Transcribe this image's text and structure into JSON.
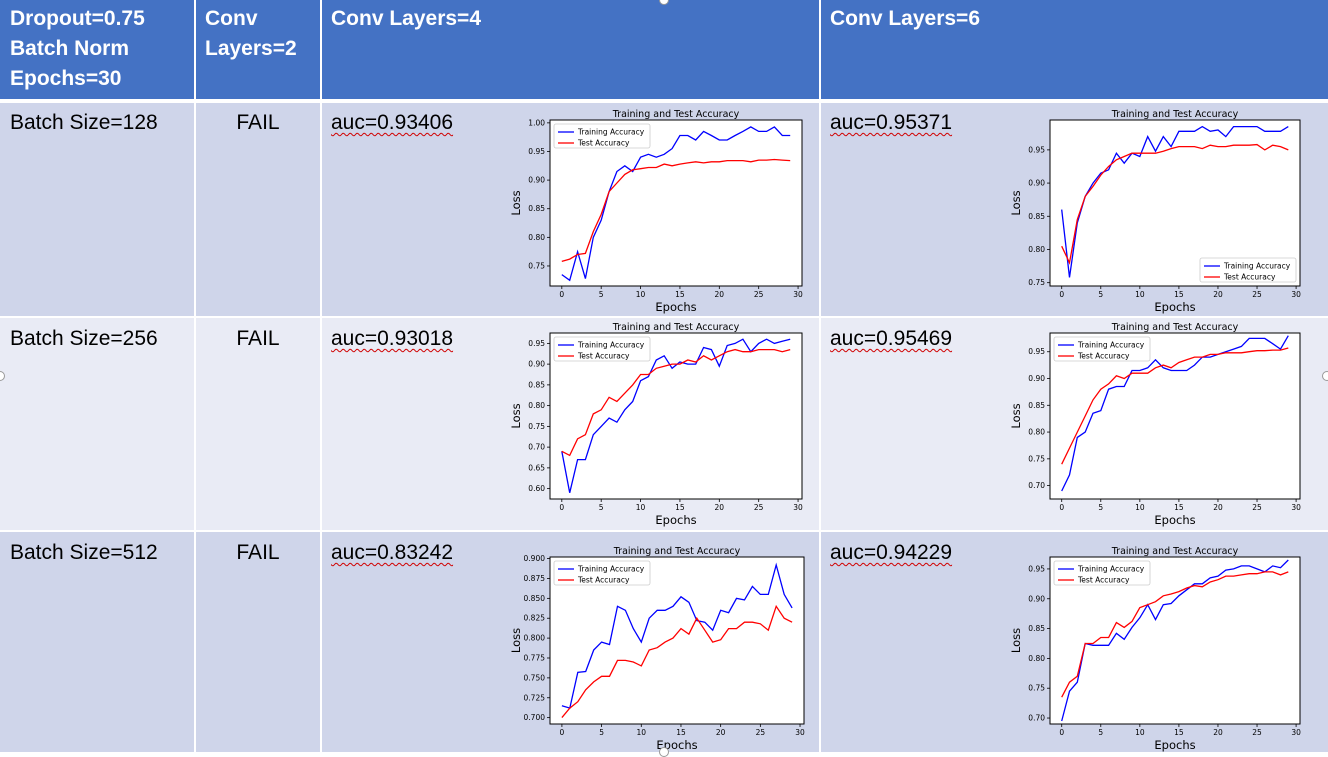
{
  "header": {
    "col1_lines": [
      "Dropout=0.75",
      "Batch Norm",
      "Epochs=30"
    ],
    "col2_lines": [
      "Conv",
      "Layers=2"
    ],
    "col3": "Conv Layers=4",
    "col4": "Conv Layers=6"
  },
  "rows": [
    {
      "batch": "Batch Size=128",
      "conv2": "FAIL",
      "auc4": "auc=0.93406",
      "auc6": "auc=0.95371"
    },
    {
      "batch": "Batch Size=256",
      "conv2": "FAIL",
      "auc4": "auc=0.93018",
      "auc6": "auc=0.95469"
    },
    {
      "batch": "Batch Size=512",
      "conv2": "FAIL",
      "auc4": "auc=0.83242",
      "auc6": "auc=0.94229"
    }
  ],
  "colors": {
    "header": "#4472c4",
    "row_even": "#cfd5ea",
    "row_odd": "#e9ebf5",
    "train": "#0000ff",
    "test": "#ff0000"
  },
  "chart_data": [
    {
      "type": "line",
      "title": "Training and Test Accuracy",
      "xlabel": "Epochs",
      "ylabel": "Loss",
      "ylim": [
        0.715,
        1.005
      ],
      "xlim": [
        -1.5,
        30.5
      ],
      "yticks": [
        "0.75",
        "0.80",
        "0.85",
        "0.90",
        "0.95",
        "1.00"
      ],
      "xticks": [
        "0",
        "5",
        "10",
        "15",
        "20",
        "25",
        "30"
      ],
      "legend_position": "top-left",
      "x": [
        0,
        1,
        2,
        3,
        4,
        5,
        6,
        7,
        8,
        9,
        10,
        11,
        12,
        13,
        14,
        15,
        16,
        17,
        18,
        19,
        20,
        21,
        22,
        23,
        24,
        25,
        26,
        27,
        28,
        29
      ],
      "series": [
        {
          "name": "Training Accuracy",
          "color": "#0000ff",
          "values": [
            0.735,
            0.725,
            0.775,
            0.728,
            0.8,
            0.83,
            0.88,
            0.915,
            0.925,
            0.915,
            0.94,
            0.945,
            0.94,
            0.945,
            0.955,
            0.978,
            0.978,
            0.97,
            0.985,
            0.978,
            0.97,
            0.97,
            0.978,
            0.985,
            0.993,
            0.985,
            0.985,
            0.993,
            0.978,
            0.978
          ]
        },
        {
          "name": "Test Accuracy",
          "color": "#ff0000",
          "values": [
            0.758,
            0.762,
            0.77,
            0.772,
            0.81,
            0.84,
            0.88,
            0.895,
            0.91,
            0.918,
            0.92,
            0.922,
            0.922,
            0.928,
            0.925,
            0.928,
            0.93,
            0.932,
            0.93,
            0.932,
            0.932,
            0.934,
            0.934,
            0.934,
            0.932,
            0.935,
            0.935,
            0.936,
            0.935,
            0.934
          ]
        }
      ]
    },
    {
      "type": "line",
      "title": "Training and Test Accuracy",
      "xlabel": "Epochs",
      "ylabel": "Loss",
      "ylim": [
        0.745,
        0.995
      ],
      "xlim": [
        -1.5,
        30.5
      ],
      "yticks": [
        "0.75",
        "0.80",
        "0.85",
        "0.90",
        "0.95"
      ],
      "xticks": [
        "0",
        "5",
        "10",
        "15",
        "20",
        "25",
        "30"
      ],
      "legend_position": "lower-right",
      "x": [
        0,
        1,
        2,
        3,
        4,
        5,
        6,
        7,
        8,
        9,
        10,
        11,
        12,
        13,
        14,
        15,
        16,
        17,
        18,
        19,
        20,
        21,
        22,
        23,
        24,
        25,
        26,
        27,
        28,
        29
      ],
      "series": [
        {
          "name": "Training Accuracy",
          "color": "#0000ff",
          "values": [
            0.86,
            0.758,
            0.84,
            0.88,
            0.9,
            0.915,
            0.92,
            0.945,
            0.93,
            0.945,
            0.94,
            0.97,
            0.948,
            0.97,
            0.955,
            0.978,
            0.978,
            0.978,
            0.985,
            0.978,
            0.98,
            0.97,
            0.985,
            0.985,
            0.985,
            0.985,
            0.978,
            0.978,
            0.978,
            0.985
          ]
        },
        {
          "name": "Test Accuracy",
          "color": "#ff0000",
          "values": [
            0.805,
            0.78,
            0.845,
            0.88,
            0.895,
            0.912,
            0.925,
            0.935,
            0.94,
            0.945,
            0.945,
            0.945,
            0.945,
            0.948,
            0.952,
            0.955,
            0.955,
            0.955,
            0.952,
            0.957,
            0.955,
            0.955,
            0.957,
            0.957,
            0.957,
            0.958,
            0.95,
            0.957,
            0.955,
            0.95
          ]
        }
      ]
    },
    {
      "type": "line",
      "title": "Training and Test Accuracy",
      "xlabel": "Epochs",
      "ylabel": "Loss",
      "ylim": [
        0.575,
        0.975
      ],
      "xlim": [
        -1.5,
        30.5
      ],
      "yticks": [
        "0.60",
        "0.65",
        "0.70",
        "0.75",
        "0.80",
        "0.85",
        "0.90",
        "0.95"
      ],
      "xticks": [
        "0",
        "5",
        "10",
        "15",
        "20",
        "25",
        "30"
      ],
      "legend_position": "top-left",
      "x": [
        0,
        1,
        2,
        3,
        4,
        5,
        6,
        7,
        8,
        9,
        10,
        11,
        12,
        13,
        14,
        15,
        16,
        17,
        18,
        19,
        20,
        21,
        22,
        23,
        24,
        25,
        26,
        27,
        28,
        29
      ],
      "series": [
        {
          "name": "Training Accuracy",
          "color": "#0000ff",
          "values": [
            0.69,
            0.59,
            0.67,
            0.67,
            0.73,
            0.75,
            0.77,
            0.76,
            0.79,
            0.81,
            0.86,
            0.87,
            0.91,
            0.92,
            0.89,
            0.905,
            0.9,
            0.9,
            0.94,
            0.935,
            0.895,
            0.945,
            0.95,
            0.96,
            0.93,
            0.95,
            0.96,
            0.95,
            0.955,
            0.96
          ]
        },
        {
          "name": "Test Accuracy",
          "color": "#ff0000",
          "values": [
            0.69,
            0.68,
            0.72,
            0.73,
            0.78,
            0.79,
            0.82,
            0.81,
            0.83,
            0.85,
            0.875,
            0.875,
            0.89,
            0.895,
            0.9,
            0.9,
            0.91,
            0.905,
            0.92,
            0.91,
            0.92,
            0.93,
            0.935,
            0.93,
            0.93,
            0.935,
            0.935,
            0.935,
            0.93,
            0.935
          ]
        }
      ]
    },
    {
      "type": "line",
      "title": "Training and Test Accuracy",
      "xlabel": "Epochs",
      "ylabel": "Loss",
      "ylim": [
        0.675,
        0.985
      ],
      "xlim": [
        -1.5,
        30.5
      ],
      "yticks": [
        "0.70",
        "0.75",
        "0.80",
        "0.85",
        "0.90",
        "0.95"
      ],
      "xticks": [
        "0",
        "5",
        "10",
        "15",
        "20",
        "25",
        "30"
      ],
      "legend_position": "top-left",
      "x": [
        0,
        1,
        2,
        3,
        4,
        5,
        6,
        7,
        8,
        9,
        10,
        11,
        12,
        13,
        14,
        15,
        16,
        17,
        18,
        19,
        20,
        21,
        22,
        23,
        24,
        25,
        26,
        27,
        28,
        29
      ],
      "series": [
        {
          "name": "Training Accuracy",
          "color": "#0000ff",
          "values": [
            0.69,
            0.72,
            0.79,
            0.8,
            0.835,
            0.84,
            0.88,
            0.885,
            0.885,
            0.915,
            0.915,
            0.92,
            0.935,
            0.92,
            0.915,
            0.915,
            0.915,
            0.925,
            0.94,
            0.94,
            0.945,
            0.95,
            0.955,
            0.96,
            0.975,
            0.975,
            0.975,
            0.965,
            0.955,
            0.98
          ]
        },
        {
          "name": "Test Accuracy",
          "color": "#ff0000",
          "values": [
            0.74,
            0.77,
            0.8,
            0.83,
            0.86,
            0.88,
            0.89,
            0.905,
            0.9,
            0.91,
            0.91,
            0.91,
            0.92,
            0.925,
            0.92,
            0.93,
            0.935,
            0.94,
            0.94,
            0.945,
            0.945,
            0.948,
            0.948,
            0.948,
            0.95,
            0.952,
            0.952,
            0.953,
            0.953,
            0.957
          ]
        }
      ]
    },
    {
      "type": "line",
      "title": "Training and Test Accuracy",
      "xlabel": "Epochs",
      "ylabel": "Loss",
      "ylim": [
        0.692,
        0.902
      ],
      "xlim": [
        -1.5,
        30.5
      ],
      "yticks": [
        "0.700",
        "0.725",
        "0.750",
        "0.775",
        "0.800",
        "0.825",
        "0.850",
        "0.875",
        "0.900"
      ],
      "xticks": [
        "0",
        "5",
        "10",
        "15",
        "20",
        "25",
        "30"
      ],
      "legend_position": "top-left",
      "x": [
        0,
        1,
        2,
        3,
        4,
        5,
        6,
        7,
        8,
        9,
        10,
        11,
        12,
        13,
        14,
        15,
        16,
        17,
        18,
        19,
        20,
        21,
        22,
        23,
        24,
        25,
        26,
        27,
        28,
        29
      ],
      "series": [
        {
          "name": "Training Accuracy",
          "color": "#0000ff",
          "values": [
            0.715,
            0.712,
            0.757,
            0.758,
            0.785,
            0.795,
            0.792,
            0.84,
            0.835,
            0.812,
            0.795,
            0.825,
            0.835,
            0.835,
            0.84,
            0.852,
            0.845,
            0.822,
            0.82,
            0.81,
            0.835,
            0.832,
            0.85,
            0.848,
            0.865,
            0.855,
            0.855,
            0.892,
            0.855,
            0.838
          ]
        },
        {
          "name": "Test Accuracy",
          "color": "#ff0000",
          "values": [
            0.7,
            0.712,
            0.72,
            0.735,
            0.745,
            0.752,
            0.752,
            0.772,
            0.772,
            0.77,
            0.765,
            0.785,
            0.788,
            0.795,
            0.8,
            0.812,
            0.805,
            0.825,
            0.81,
            0.795,
            0.798,
            0.812,
            0.812,
            0.82,
            0.82,
            0.818,
            0.81,
            0.84,
            0.825,
            0.82
          ]
        }
      ]
    },
    {
      "type": "line",
      "title": "Training and Test Accuracy",
      "xlabel": "Epochs",
      "ylabel": "Loss",
      "ylim": [
        0.69,
        0.97
      ],
      "xlim": [
        -1.5,
        30.5
      ],
      "yticks": [
        "0.70",
        "0.75",
        "0.80",
        "0.85",
        "0.90",
        "0.95"
      ],
      "xticks": [
        "0",
        "5",
        "10",
        "15",
        "20",
        "25",
        "30"
      ],
      "legend_position": "top-left",
      "x": [
        0,
        1,
        2,
        3,
        4,
        5,
        6,
        7,
        8,
        9,
        10,
        11,
        12,
        13,
        14,
        15,
        16,
        17,
        18,
        19,
        20,
        21,
        22,
        23,
        24,
        25,
        26,
        27,
        28,
        29
      ],
      "series": [
        {
          "name": "Training Accuracy",
          "color": "#0000ff",
          "values": [
            0.695,
            0.745,
            0.76,
            0.825,
            0.822,
            0.822,
            0.822,
            0.842,
            0.832,
            0.852,
            0.868,
            0.89,
            0.865,
            0.89,
            0.892,
            0.905,
            0.915,
            0.925,
            0.925,
            0.935,
            0.938,
            0.948,
            0.95,
            0.955,
            0.955,
            0.95,
            0.945,
            0.955,
            0.952,
            0.965
          ]
        },
        {
          "name": "Test Accuracy",
          "color": "#ff0000",
          "values": [
            0.735,
            0.76,
            0.77,
            0.825,
            0.825,
            0.835,
            0.835,
            0.86,
            0.852,
            0.862,
            0.885,
            0.89,
            0.895,
            0.905,
            0.908,
            0.912,
            0.918,
            0.922,
            0.92,
            0.928,
            0.932,
            0.938,
            0.938,
            0.94,
            0.942,
            0.942,
            0.945,
            0.945,
            0.94,
            0.945
          ]
        }
      ]
    }
  ]
}
